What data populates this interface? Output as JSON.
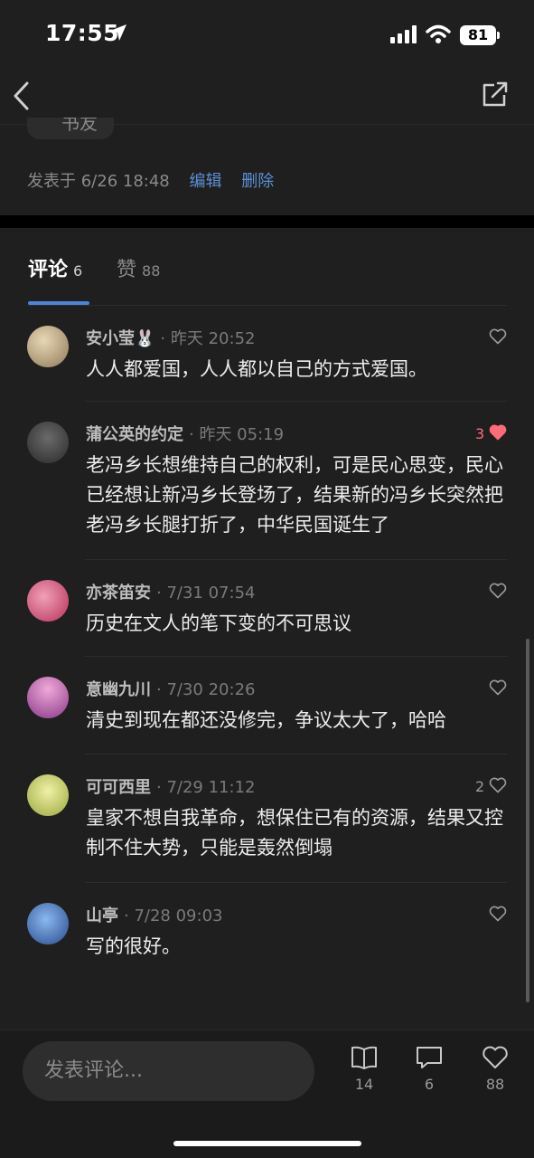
{
  "status_bar": {
    "time": "17:55",
    "battery": "81"
  },
  "post": {
    "tag_label": "书友",
    "posted_prefix": "发表于",
    "posted_time": "6/26 18:48",
    "edit_label": "编辑",
    "delete_label": "删除"
  },
  "tabs": {
    "comments_label": "评论",
    "comments_count": "6",
    "likes_label": "赞",
    "likes_count": "88"
  },
  "comments": [
    {
      "name": "安小莹🐰",
      "time": "昨天 20:52",
      "text": "人人都爱国，人人都以自己的方式爱国。",
      "likes": "",
      "liked": false,
      "avatar_color": "#c9b48e"
    },
    {
      "name": "蒲公英的约定",
      "time": "昨天 05:19",
      "text": "老冯乡长想维持自己的权利，可是民心思变，民心已经想让新冯乡长登场了，结果新的冯乡长突然把老冯乡长腿打折了，中华民国诞生了",
      "likes": "3",
      "liked": true,
      "avatar_color": "#4a4a4a"
    },
    {
      "name": "亦茶笛安",
      "time": "7/31 07:54",
      "text": "历史在文人的笔下变的不可思议",
      "likes": "",
      "liked": false,
      "avatar_color": "#d86a8a"
    },
    {
      "name": "意幽九川",
      "time": "7/30 20:26",
      "text": "清史到现在都还没修完，争议太大了，哈哈",
      "likes": "",
      "liked": false,
      "avatar_color": "#c75a9a"
    },
    {
      "name": "可可西里",
      "time": "7/29 11:12",
      "text": "皇家不想自我革命，想保住已有的资源，结果又控制不住大势，只能是轰然倒塌",
      "likes": "2",
      "liked": false,
      "avatar_color": "#d9d98a"
    },
    {
      "name": "山亭",
      "time": "7/28 09:03",
      "text": "写的很好。",
      "likes": "",
      "liked": false,
      "avatar_color": "#3a6ab8"
    }
  ],
  "bottom_bar": {
    "input_placeholder": "发表评论...",
    "read_count": "14",
    "comment_count": "6",
    "like_count": "88"
  },
  "colors": {
    "accent": "#4a86d8",
    "link": "#5c8fd6",
    "liked": "#ff6b7a",
    "background": "#1f1f1f"
  },
  "icons": [
    "location-arrow-icon",
    "signal-icon",
    "wifi-icon",
    "back-icon",
    "share-icon",
    "heart-icon",
    "book-icon",
    "comment-icon"
  ]
}
